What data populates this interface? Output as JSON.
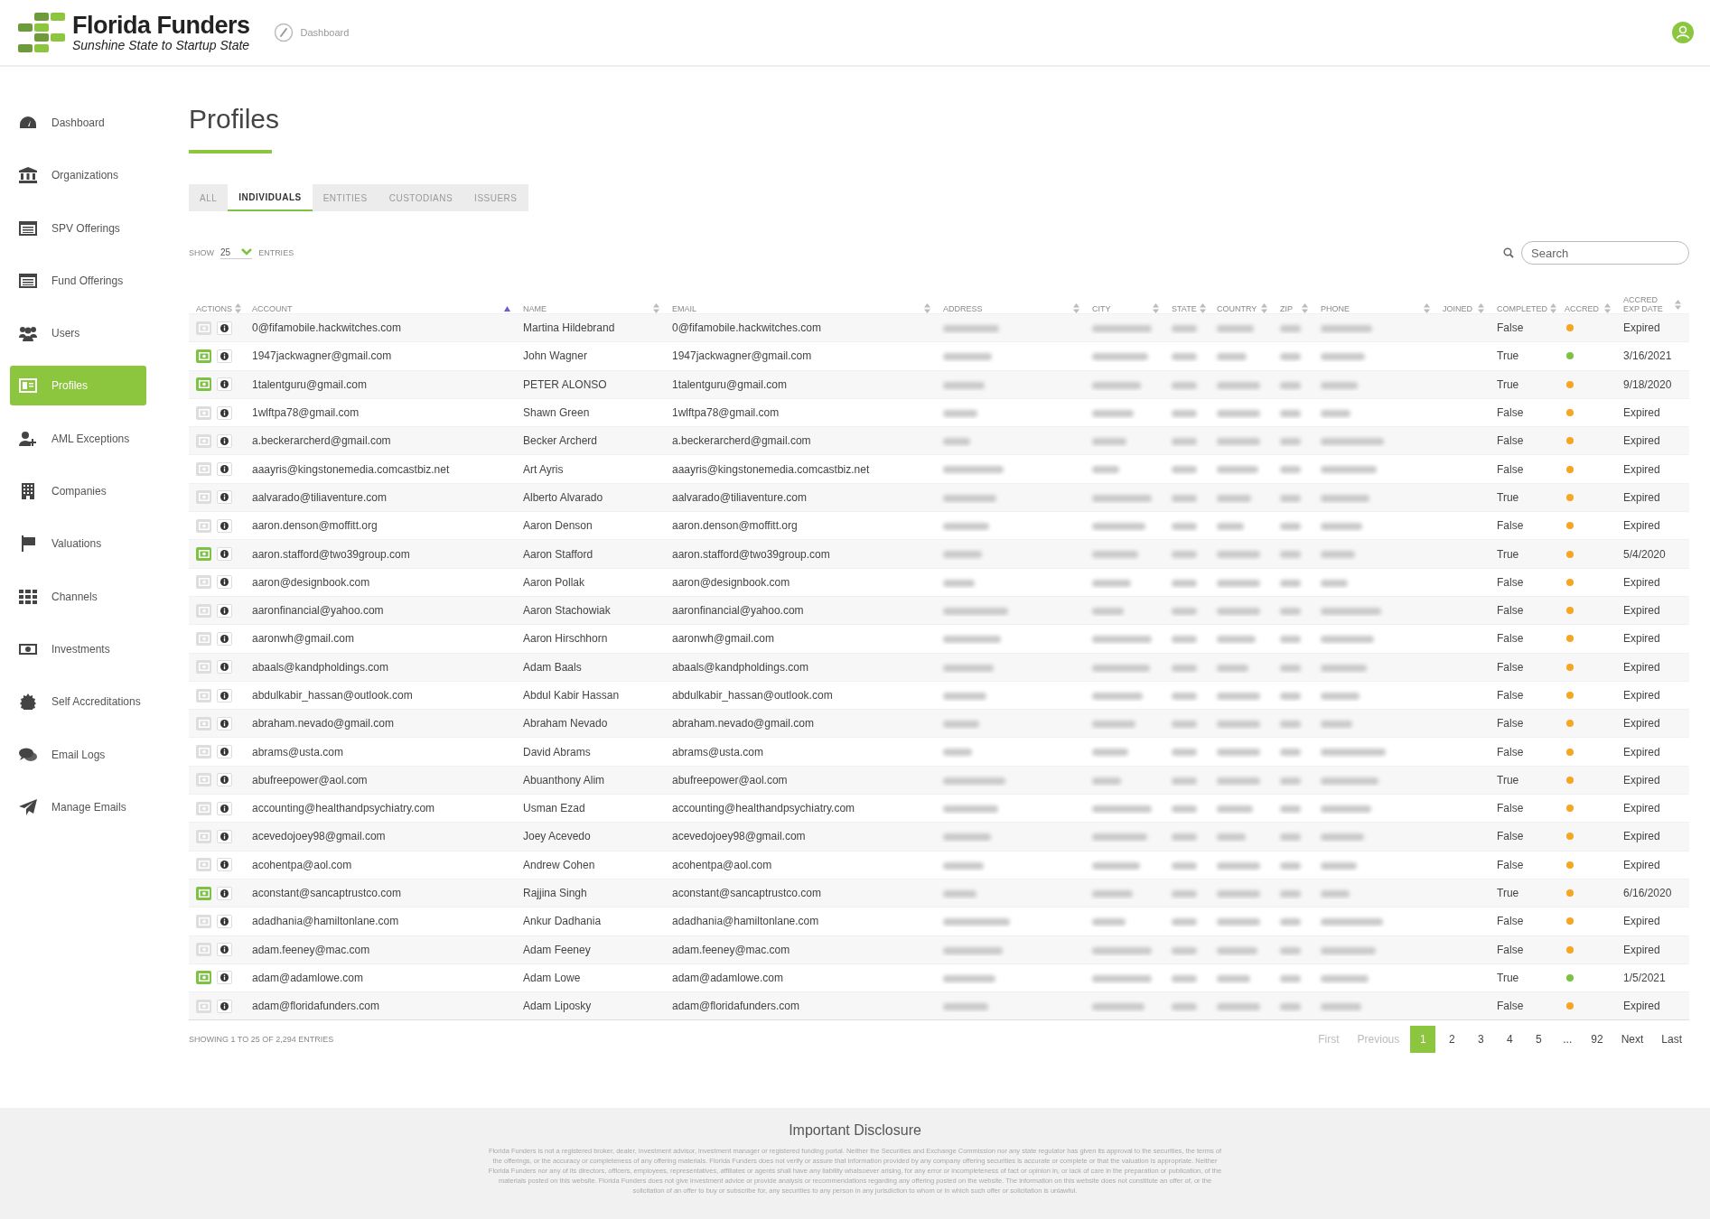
{
  "header": {
    "logo_title": "Florida Funders",
    "logo_tagline": "Sunshine State to Startup State",
    "breadcrumb": "Dashboard"
  },
  "sidebar": {
    "items": [
      {
        "label": "Dashboard",
        "selected": false
      },
      {
        "label": "Organizations",
        "selected": false
      },
      {
        "label": "SPV Offerings",
        "selected": false
      },
      {
        "label": "Fund Offerings",
        "selected": false
      },
      {
        "label": "Users",
        "selected": false
      },
      {
        "label": "Profiles",
        "selected": true
      },
      {
        "label": "AML Exceptions",
        "selected": false
      },
      {
        "label": "Companies",
        "selected": false
      },
      {
        "label": "Valuations",
        "selected": false
      },
      {
        "label": "Channels",
        "selected": false
      },
      {
        "label": "Investments",
        "selected": false
      },
      {
        "label": "Self Accreditations",
        "selected": false
      },
      {
        "label": "Email Logs",
        "selected": false
      },
      {
        "label": "Manage Emails",
        "selected": false
      }
    ]
  },
  "page": {
    "title": "Profiles"
  },
  "tabs": [
    {
      "label": "ALL",
      "selected": false
    },
    {
      "label": "INDIVIDUALS",
      "selected": true
    },
    {
      "label": "ENTITIES",
      "selected": false
    },
    {
      "label": "CUSTODIANS",
      "selected": false
    },
    {
      "label": "ISSUERS",
      "selected": false
    }
  ],
  "entries": {
    "show_label": "SHOW",
    "value": "25",
    "entries_label": "ENTRIES"
  },
  "search": {
    "placeholder": "Search"
  },
  "table": {
    "columns": [
      {
        "label": "ACTIONS",
        "sorted": false
      },
      {
        "label": "ACCOUNT",
        "sorted": true
      },
      {
        "label": "NAME",
        "sorted": false
      },
      {
        "label": "EMAIL",
        "sorted": false
      },
      {
        "label": "ADDRESS",
        "sorted": false
      },
      {
        "label": "CITY",
        "sorted": false
      },
      {
        "label": "STATE",
        "sorted": false
      },
      {
        "label": "COUNTRY",
        "sorted": false
      },
      {
        "label": "ZIP",
        "sorted": false
      },
      {
        "label": "PHONE",
        "sorted": false
      },
      {
        "label": "JOINED",
        "sorted": false
      },
      {
        "label": "COMPLETED",
        "sorted": false
      },
      {
        "label": "ACCRED",
        "sorted": false
      },
      {
        "label": "ACCRED EXP DATE",
        "sorted": false
      }
    ],
    "rows": [
      {
        "verified": false,
        "account": "0@fifamobile.hackwitches.com",
        "name": "Martina Hildebrand",
        "email": "0@fifamobile.hackwitches.com",
        "completed": "False",
        "color": "#f5a623",
        "exp_date": "Expired"
      },
      {
        "verified": true,
        "account": "1947jackwagner@gmail.com",
        "name": "John Wagner",
        "email": "1947jackwagner@gmail.com",
        "completed": "True",
        "color": "#7dc242",
        "exp_date": "3/16/2021"
      },
      {
        "verified": true,
        "account": "1talentguru@gmail.com",
        "name": "PETER ALONSO",
        "email": "1talentguru@gmail.com",
        "completed": "True",
        "color": "#f5a623",
        "exp_date": "9/18/2020"
      },
      {
        "verified": false,
        "account": "1wlftpa78@gmail.com",
        "name": "Shawn Green",
        "email": "1wlftpa78@gmail.com",
        "completed": "False",
        "color": "#f5a623",
        "exp_date": "Expired"
      },
      {
        "verified": false,
        "account": "a.beckerarcherd@gmail.com",
        "name": "Becker Archerd",
        "email": "a.beckerarcherd@gmail.com",
        "completed": "False",
        "color": "#f5a623",
        "exp_date": "Expired"
      },
      {
        "verified": false,
        "account": "aaayris@kingstonemedia.comcastbiz.net",
        "name": "Art Ayris",
        "email": "aaayris@kingstonemedia.comcastbiz.net",
        "completed": "False",
        "color": "#f5a623",
        "exp_date": "Expired"
      },
      {
        "verified": false,
        "account": "aalvarado@tiliaventure.com",
        "name": "Alberto Alvarado",
        "email": "aalvarado@tiliaventure.com",
        "completed": "True",
        "color": "#f5a623",
        "exp_date": "Expired"
      },
      {
        "verified": false,
        "account": "aaron.denson@moffitt.org",
        "name": "Aaron Denson",
        "email": "aaron.denson@moffitt.org",
        "completed": "False",
        "color": "#f5a623",
        "exp_date": "Expired"
      },
      {
        "verified": true,
        "account": "aaron.stafford@two39group.com",
        "name": "Aaron Stafford",
        "email": "aaron.stafford@two39group.com",
        "completed": "True",
        "color": "#f5a623",
        "exp_date": "5/4/2020"
      },
      {
        "verified": false,
        "account": "aaron@designbook.com",
        "name": "Aaron Pollak",
        "email": "aaron@designbook.com",
        "completed": "False",
        "color": "#f5a623",
        "exp_date": "Expired"
      },
      {
        "verified": false,
        "account": "aaronfinancial@yahoo.com",
        "name": "Aaron Stachowiak",
        "email": "aaronfinancial@yahoo.com",
        "completed": "False",
        "color": "#f5a623",
        "exp_date": "Expired"
      },
      {
        "verified": false,
        "account": "aaronwh@gmail.com",
        "name": "Aaron Hirschhorn",
        "email": "aaronwh@gmail.com",
        "completed": "False",
        "color": "#f5a623",
        "exp_date": "Expired"
      },
      {
        "verified": false,
        "account": "abaals@kandpholdings.com",
        "name": "Adam Baals",
        "email": "abaals@kandpholdings.com",
        "completed": "False",
        "color": "#f5a623",
        "exp_date": "Expired"
      },
      {
        "verified": false,
        "account": "abdulkabir_hassan@outlook.com",
        "name": "Abdul Kabir Hassan",
        "email": "abdulkabir_hassan@outlook.com",
        "completed": "False",
        "color": "#f5a623",
        "exp_date": "Expired"
      },
      {
        "verified": false,
        "account": "abraham.nevado@gmail.com",
        "name": "Abraham Nevado",
        "email": "abraham.nevado@gmail.com",
        "completed": "False",
        "color": "#f5a623",
        "exp_date": "Expired"
      },
      {
        "verified": false,
        "account": "abrams@usta.com",
        "name": "David Abrams",
        "email": "abrams@usta.com",
        "completed": "False",
        "color": "#f5a623",
        "exp_date": "Expired"
      },
      {
        "verified": false,
        "account": "abufreepower@aol.com",
        "name": "Abuanthony Alim",
        "email": "abufreepower@aol.com",
        "completed": "True",
        "color": "#f5a623",
        "exp_date": "Expired"
      },
      {
        "verified": false,
        "account": "accounting@healthandpsychiatry.com",
        "name": "Usman Ezad",
        "email": "accounting@healthandpsychiatry.com",
        "completed": "False",
        "color": "#f5a623",
        "exp_date": "Expired"
      },
      {
        "verified": false,
        "account": "acevedojoey98@gmail.com",
        "name": "Joey Acevedo",
        "email": "acevedojoey98@gmail.com",
        "completed": "False",
        "color": "#f5a623",
        "exp_date": "Expired"
      },
      {
        "verified": false,
        "account": "acohentpa@aol.com",
        "name": "Andrew Cohen",
        "email": "acohentpa@aol.com",
        "completed": "False",
        "color": "#f5a623",
        "exp_date": "Expired"
      },
      {
        "verified": true,
        "account": "aconstant@sancaptrustco.com",
        "name": "Rajjina Singh",
        "email": "aconstant@sancaptrustco.com",
        "completed": "True",
        "color": "#f5a623",
        "exp_date": "6/16/2020"
      },
      {
        "verified": false,
        "account": "adadhania@hamiltonlane.com",
        "name": "Ankur Dadhania",
        "email": "adadhania@hamiltonlane.com",
        "completed": "False",
        "color": "#f5a623",
        "exp_date": "Expired"
      },
      {
        "verified": false,
        "account": "adam.feeney@mac.com",
        "name": "Adam Feeney",
        "email": "adam.feeney@mac.com",
        "completed": "False",
        "color": "#f5a623",
        "exp_date": "Expired"
      },
      {
        "verified": true,
        "account": "adam@adamlowe.com",
        "name": "Adam Lowe",
        "email": "adam@adamlowe.com",
        "completed": "True",
        "color": "#7dc242",
        "exp_date": "1/5/2021"
      },
      {
        "verified": false,
        "account": "adam@floridafunders.com",
        "name": "Adam Liposky",
        "email": "adam@floridafunders.com",
        "completed": "False",
        "color": "#f5a623",
        "exp_date": "Expired"
      }
    ]
  },
  "summary": "SHOWING 1 TO 25 OF 2,294 ENTRIES",
  "pagination": [
    {
      "label": "First",
      "selected": false,
      "disabled": true
    },
    {
      "label": "Previous",
      "selected": false,
      "disabled": true
    },
    {
      "label": "1",
      "selected": true,
      "disabled": false
    },
    {
      "label": "2",
      "selected": false,
      "disabled": false
    },
    {
      "label": "3",
      "selected": false,
      "disabled": false
    },
    {
      "label": "4",
      "selected": false,
      "disabled": false
    },
    {
      "label": "5",
      "selected": false,
      "disabled": false
    },
    {
      "label": "...",
      "selected": false,
      "disabled": false
    },
    {
      "label": "92",
      "selected": false,
      "disabled": false
    },
    {
      "label": "Next",
      "selected": false,
      "disabled": false
    },
    {
      "label": "Last",
      "selected": false,
      "disabled": false
    }
  ],
  "footer": {
    "title": "Important Disclosure",
    "text": "Florida Funders is not a registered broker, dealer, investment advisor, investment manager or registered funding portal. Neither the Securities and Exchange Commission nor any state regulator has given its approval to the securities, the terms of the offerings, or the accuracy or completeness of any offering materials. Florida Funders does not verify or assure that information provided by any company offering securities is accurate or complete or that the valuation is appropriate. Neither Florida Funders nor any of its directors, officers, employees, representatives, affiliates or agents shall have any liability whatsoever arising, for any error or incompleteness of fact or opinion in, or lack of care in the preparation or publication, of the materials posted on this website. Florida Funders does not give investment advice or provide analysis or recommendations regarding any offering posted on the website. The information on this website does not constitute an offer of, or the solicitation of an offer to buy or subscribe for, any securities to any person in any jurisdiction to whom or in which such offer or solicitation is unlawful."
  }
}
